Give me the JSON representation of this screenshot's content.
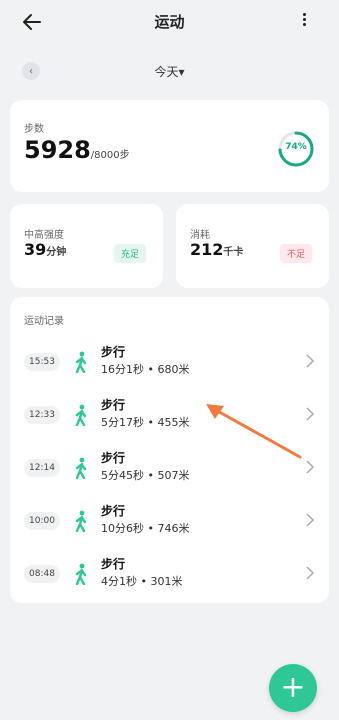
{
  "header": {
    "title": "运动"
  },
  "date_nav": {
    "label": "今天",
    "dropdown_glyph": "▾"
  },
  "steps": {
    "label": "步数",
    "count": "5928",
    "goal": "/8000步",
    "percent_label": "74%",
    "percent_value": 74
  },
  "intensity": {
    "label": "中高强度",
    "value": "39",
    "unit": "分钟",
    "status": "充足"
  },
  "calories": {
    "label": "消耗",
    "value": "212",
    "unit": "千卡",
    "status": "不足"
  },
  "records": {
    "title": "运动记录",
    "items": [
      {
        "time": "15:53",
        "name": "步行",
        "detail": "16分1秒 • 680米"
      },
      {
        "time": "12:33",
        "name": "步行",
        "detail": "5分17秒 • 455米"
      },
      {
        "time": "12:14",
        "name": "步行",
        "detail": "5分45秒 • 507米"
      },
      {
        "time": "10:00",
        "name": "步行",
        "detail": "10分6秒 • 746米"
      },
      {
        "time": "08:48",
        "name": "步行",
        "detail": "4分1秒 • 301米"
      }
    ]
  },
  "colors": {
    "accent": "#2ec795",
    "ring": "#17a986",
    "ok_bg": "#e4f6ef",
    "ok_text": "#2bb68a",
    "warn_bg": "#fde8ea",
    "warn_text": "#e05a6a",
    "arrow": "#f07b3f"
  },
  "icons": {
    "back": "back-arrow-icon",
    "more": "more-vertical-icon",
    "prev": "chevron-left-icon",
    "walk": "walking-person-icon",
    "chevron": "chevron-right-icon",
    "add": "plus-icon"
  }
}
